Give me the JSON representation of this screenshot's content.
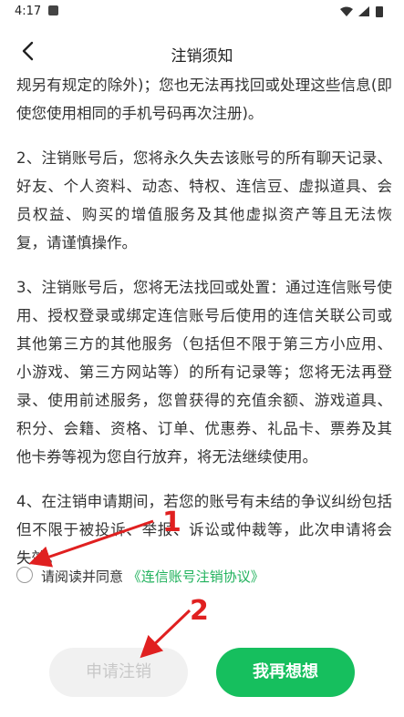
{
  "status_bar": {
    "time": "4:17"
  },
  "header": {
    "title": "注销须知"
  },
  "content": {
    "paragraphs": [
      "规另有规定的除外)；您也无法再找回或处理这些信息(即使您使用相同的手机号码再次注册)。",
      "2、注销账号后，您将永久失去该账号的所有聊天记录、好友、个人资料、动态、特权、连信豆、虚拟道具、会员权益、购买的增值服务及其他虚拟资产等且无法恢复，请谨慎操作。",
      "3、注销账号后，您将无法找回或处置：通过连信账号使用、授权登录或绑定连信账号后使用的连信关联公司或其他第三方的其他服务（包括但不限于第三方小应用、小游戏、第三方网站等）的所有记录等；您将无法再登录、使用前述服务，您曾获得的充值余额、游戏道具、积分、会籍、资格、订单、优惠券、礼品卡、票券及其他卡券等视为您自行放弃，将无法继续使用。",
      "4、在注销申请期间，若您的账号有未结的争议纠纷包括但不限于被投诉、举报、诉讼或仲裁等，此次申请将会失效。"
    ]
  },
  "agreement": {
    "prefix": "请阅读并同意 ",
    "link": "《连信账号注销协议》",
    "checked": false
  },
  "buttons": {
    "apply": "申请注销",
    "rethink": "我再想想"
  },
  "annotations": {
    "label_1": "1",
    "label_2": "2",
    "arrow_color": "#e02020"
  },
  "colors": {
    "accent_green": "#16bf5e",
    "link_green": "#21b25d",
    "disabled_bg": "#f1f1f1",
    "disabled_text": "#c8c8c8"
  }
}
